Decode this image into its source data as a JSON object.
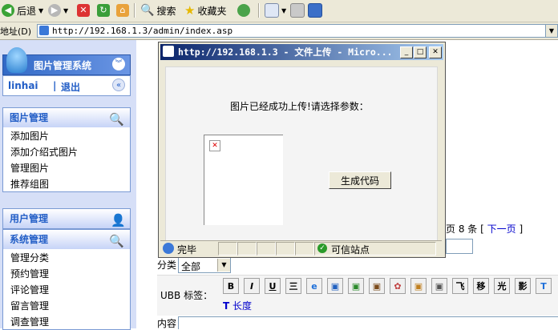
{
  "toolbar": {
    "back_label": "后退",
    "search_label": "搜索",
    "favorites_label": "收藏夹"
  },
  "address_bar": {
    "label": "地址(D)",
    "url": "http://192.168.1.3/admin/index.asp"
  },
  "sidebar": {
    "app_title": "图片管理系统",
    "user_name": "linhai",
    "logout_separator": "|",
    "logout_label": "退出",
    "sections": [
      {
        "title": "图片管理",
        "items": [
          "添加图片",
          "添加介绍式图片",
          "管理图片",
          "推荐组图"
        ]
      },
      {
        "title": "用户管理",
        "items": []
      },
      {
        "title": "系统管理",
        "items": [
          "管理分类",
          "预约管理",
          "评论管理",
          "留言管理",
          "调查管理"
        ]
      }
    ]
  },
  "main": {
    "pagination": {
      "text": "页 8 条 [",
      "next_label": "下一页",
      "close": "]"
    },
    "category_label": "分类",
    "category_select_value": "全部",
    "ubb_label": "UBB 标签：",
    "ubb_buttons": [
      "B",
      "I",
      "U",
      "三",
      "e",
      "▣",
      "▣",
      "▣",
      "✿",
      "▣",
      "▣",
      "飞",
      "移",
      "光",
      "影",
      "T"
    ],
    "ubb_second_row": {
      "icon": "T",
      "label": "长度"
    },
    "content_label": "内容"
  },
  "dialog": {
    "title": "http://192.168.1.3 - 文件上传 - Micro...",
    "message": "图片已经成功上传!请选择参数：",
    "generate_button": "生成代码",
    "status_text": "完毕",
    "trusted_zone": "可信站点"
  },
  "colors": {
    "title_bar_start": "#0a246a",
    "title_bar_end": "#a6caf0",
    "sidebar_bg": "#d6dff7",
    "sidebar_header_text": "#215dc6",
    "link_blue": "#0000cc"
  }
}
